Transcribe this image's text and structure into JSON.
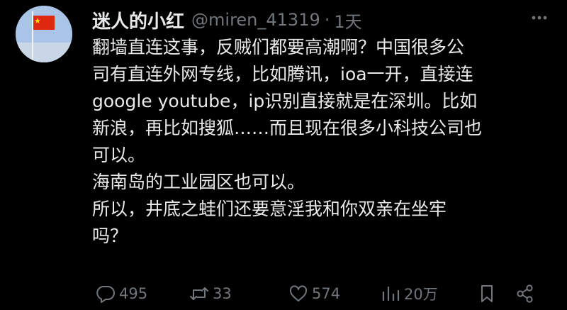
{
  "tweet": {
    "display_name": "迷人的小红",
    "handle": "@miren_41319",
    "separator": "·",
    "time": "1天",
    "body_lines": [
      "翻墙直连这事，反贼们都要高潮啊？中国很多公",
      "司有直连外网专线，比如腾讯，ioa一开，直接连",
      "google youtube，ip识别直接就是在深圳。比如",
      "新浪，再比如搜狐……而且现在很多小科技公司也",
      "可以。",
      "海南岛的工业园区也可以。",
      "所以，井底之蛙们还要意淫我和你双亲在坐牢",
      "吗？"
    ]
  },
  "avatar": {
    "icon": "flag-avatar-icon",
    "flag_color": "#de2910",
    "star_color": "#ffde00",
    "sky_color": "#a9c4e6"
  },
  "actions": {
    "replies": "495",
    "reposts": "33",
    "likes": "574",
    "views": "20万"
  },
  "colors": {
    "background": "#000000",
    "text": "#e7e9ea",
    "secondary": "#71767b"
  }
}
